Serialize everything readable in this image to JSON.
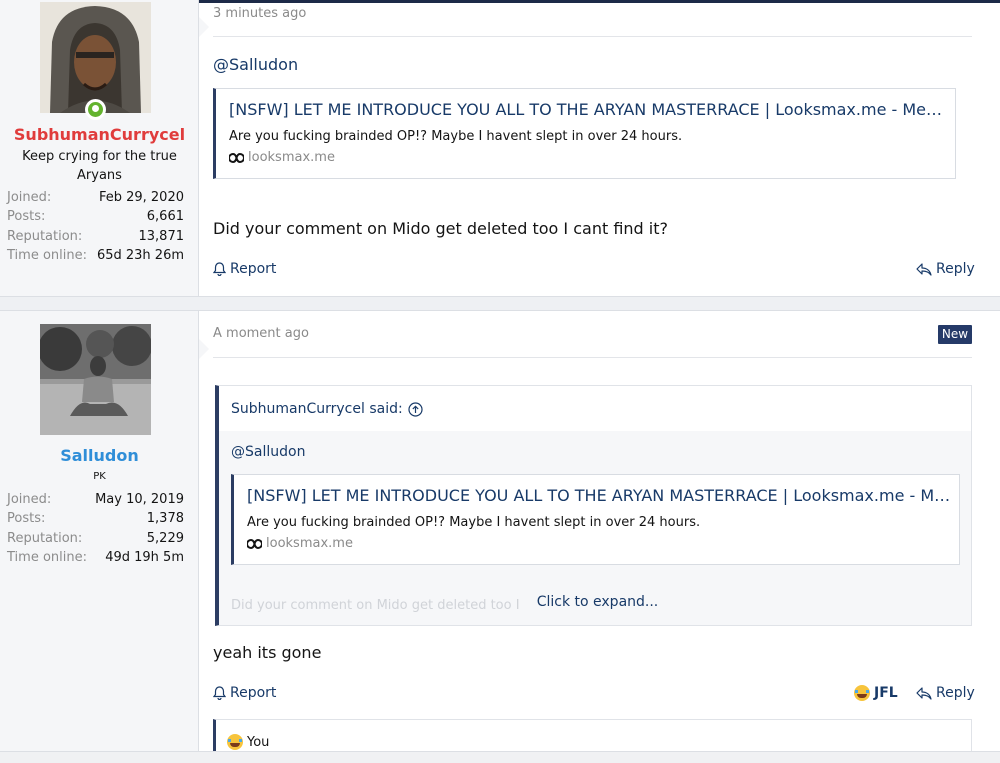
{
  "posts": [
    {
      "user": {
        "name": "SubhumanCurrycel",
        "name_color": "#e03c3c",
        "title_line1": "Keep crying for the true",
        "title_line2": "Aryans",
        "online": true,
        "stats": [
          {
            "k": "Joined:",
            "v": "Feb 29, 2020"
          },
          {
            "k": "Posts:",
            "v": "6,661"
          },
          {
            "k": "Reputation:",
            "v": "13,871"
          },
          {
            "k": "Time online:",
            "v": "65d 23h 26m"
          }
        ]
      },
      "time": "3 minutes ago",
      "mention": "@Salludon",
      "embed": {
        "title": "[NSFW] LET ME INTRODUCE YOU ALL TO THE ARYAN MASTERRACE | Looksmax.me - Mens S...",
        "desc": "Are you fucking brainded OP!? Maybe I havent slept in over 24 hours.",
        "url": "looksmax.me"
      },
      "body": "Did your comment on Mido get deleted too I cant find it?",
      "report_label": "Report",
      "reply_label": "Reply"
    },
    {
      "user": {
        "name": "Salludon",
        "name_color": "#2f8ed8",
        "title_line1": "PK",
        "stats": [
          {
            "k": "Joined:",
            "v": "May 10, 2019"
          },
          {
            "k": "Posts:",
            "v": "1,378"
          },
          {
            "k": "Reputation:",
            "v": "5,229"
          },
          {
            "k": "Time online:",
            "v": "49d 19h 5m"
          }
        ]
      },
      "time": "A moment ago",
      "badge": "New",
      "quote": {
        "author_said": "SubhumanCurrycel said:",
        "mention": "@Salludon",
        "embed": {
          "title": "[NSFW] LET ME INTRODUCE YOU ALL TO THE ARYAN MASTERRACE | Looksmax.me - Mens...",
          "desc": "Are you fucking brainded OP!? Maybe I havent slept in over 24 hours.",
          "url": "looksmax.me"
        },
        "faded_text": "Did your comment on Mido get deleted too I",
        "expand_label": "Click to expand..."
      },
      "body": "yeah its gone",
      "report_label": "Report",
      "reaction_label": "JFL",
      "reply_label": "Reply",
      "reaction_bar_label": "You"
    }
  ]
}
